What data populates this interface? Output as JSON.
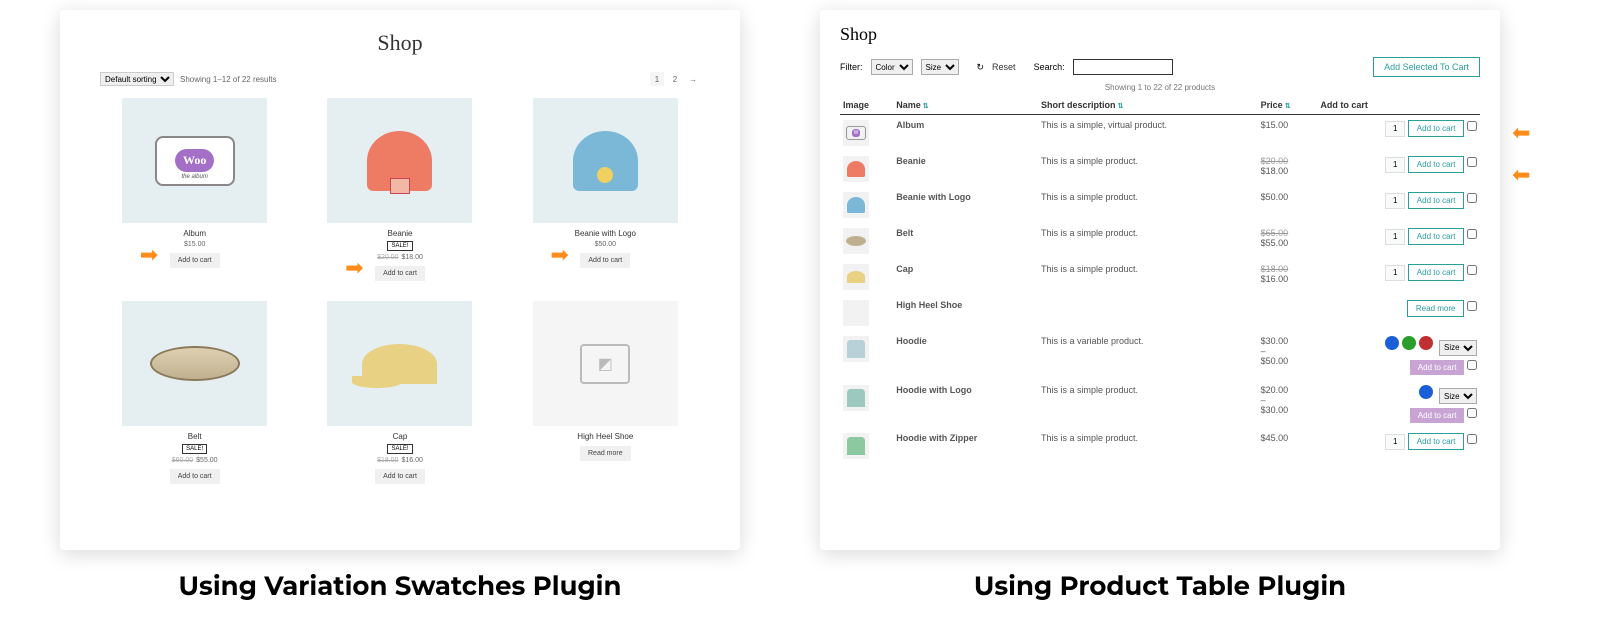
{
  "left": {
    "title": "Shop",
    "sort_label": "Default sorting",
    "results": "Showing 1–12 of 22 results",
    "pager": [
      "1",
      "2",
      "→"
    ],
    "products": [
      {
        "name": "Album",
        "price": "$15.00",
        "btn": "Add to cart",
        "sale": false,
        "old": ""
      },
      {
        "name": "Beanie",
        "price": "$18.00",
        "btn": "Add to cart",
        "sale": true,
        "old": "$20.00"
      },
      {
        "name": "Beanie with Logo",
        "price": "$50.00",
        "btn": "Add to cart",
        "sale": false,
        "old": ""
      },
      {
        "name": "Belt",
        "price": "$55.00",
        "btn": "Add to cart",
        "sale": true,
        "old": "$60.00"
      },
      {
        "name": "Cap",
        "price": "$16.00",
        "btn": "Add to cart",
        "sale": true,
        "old": "$18.00"
      },
      {
        "name": "High Heel Shoe",
        "price": "",
        "btn": "Read more",
        "sale": false,
        "old": ""
      }
    ]
  },
  "right": {
    "title": "Shop",
    "filter_label": "Filter:",
    "color_label": "Color",
    "size_label": "Size",
    "reset_label": "Reset",
    "search_label": "Search:",
    "add_selected_label": "Add Selected To Cart",
    "showing": "Showing 1 to 22 of 22 products",
    "cols": {
      "image": "Image",
      "name": "Name",
      "desc": "Short description",
      "price": "Price",
      "add": "Add to cart"
    },
    "btn_add": "Add to cart",
    "btn_read": "Read more",
    "size_opt": "Size",
    "rows": [
      {
        "name": "Album",
        "desc": "This is a simple, virtual product.",
        "price": "$15.00",
        "old": "",
        "qty": true,
        "btn": "teal",
        "chk": true
      },
      {
        "name": "Beanie",
        "desc": "This is a simple product.",
        "price": "$18.00",
        "old": "$20.00",
        "qty": true,
        "btn": "teal",
        "chk": true
      },
      {
        "name": "Beanie with Logo",
        "desc": "This is a simple product.",
        "price": "$50.00",
        "old": "",
        "qty": true,
        "btn": "teal",
        "chk": true
      },
      {
        "name": "Belt",
        "desc": "This is a simple product.",
        "price": "$55.00",
        "old": "$65.00",
        "qty": true,
        "btn": "teal",
        "chk": true
      },
      {
        "name": "Cap",
        "desc": "This is a simple product.",
        "price": "$16.00",
        "old": "$18.00",
        "qty": true,
        "btn": "teal",
        "chk": true
      },
      {
        "name": "High Heel Shoe",
        "desc": "",
        "price": "",
        "old": "",
        "qty": false,
        "btn": "read",
        "chk": true
      },
      {
        "name": "Hoodie",
        "desc": "This is a variable product.",
        "price": "$30.00 – $50.00",
        "old": "",
        "qty": false,
        "btn": "purple",
        "chk": true,
        "swatches": true,
        "size": true
      },
      {
        "name": "Hoodie with Logo",
        "desc": "This is a simple product.",
        "price": "$20.00 – $30.00",
        "old": "",
        "qty": false,
        "btn": "purple",
        "chk": true,
        "swatch_blue": true,
        "size": true
      },
      {
        "name": "Hoodie with Zipper",
        "desc": "This is a simple product.",
        "price": "$45.00",
        "old": "",
        "qty": true,
        "btn": "teal",
        "chk": true
      }
    ]
  },
  "captions": {
    "left": "Using Variation Swatches Plugin",
    "right": "Using Product Table Plugin"
  }
}
